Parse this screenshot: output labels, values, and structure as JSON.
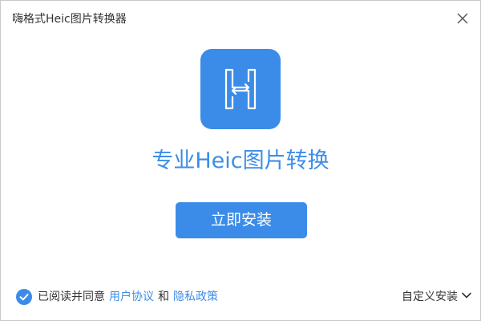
{
  "window": {
    "title": "嗨格式Heic图片转换器"
  },
  "main": {
    "headline": "专业Heic图片转换",
    "install_button_label": "立即安装"
  },
  "footer": {
    "agree_checked": true,
    "agree_prefix": "已阅读并同意",
    "user_agreement_link": "用户协议",
    "conjunction": "和",
    "privacy_policy_link": "隐私政策",
    "custom_install_label": "自定义安装"
  },
  "icons": {
    "close": "close-icon",
    "logo": "heic-logo-icon",
    "check": "checkmark-icon",
    "chevron": "chevron-down-icon"
  },
  "colors": {
    "accent": "#3b8ce8",
    "link": "#3d8de6",
    "text": "#333333",
    "background": "#ffffff"
  }
}
